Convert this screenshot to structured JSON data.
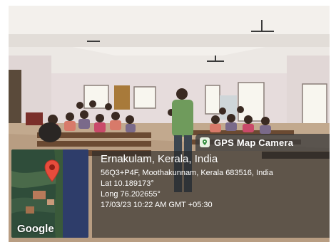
{
  "photo": {
    "subject": "classroom with seated students and a standing presenter",
    "colors": {
      "wall": "#e7dede",
      "floor": "#bfa58a",
      "ceiling": "#f1eeeb",
      "shirt": "#6f9b5c"
    }
  },
  "gps_badge": {
    "label": "GPS Map Camera",
    "icon": "gps-camera-app-icon"
  },
  "map": {
    "brand": "Google",
    "pin_color": "#e74c3c",
    "icon": "map-pin-icon"
  },
  "location": {
    "city": "Ernakulam, Kerala, India",
    "address": "56Q3+P4F, Moothakunnam, Kerala 683516, India",
    "lat": "Lat 10.189173°",
    "long": "Long 76.202655°",
    "datetime": "17/03/23 10:22 AM GMT +05:30"
  }
}
